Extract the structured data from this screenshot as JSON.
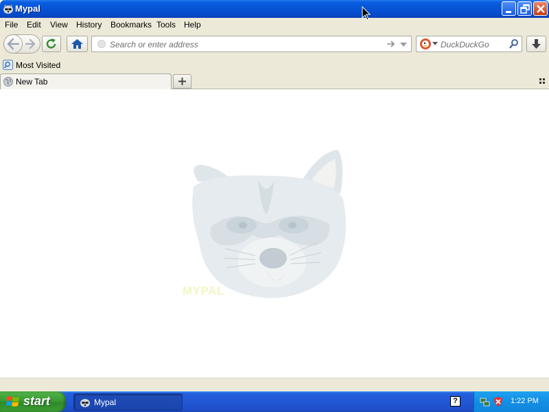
{
  "window": {
    "title": "Mypal",
    "controls": {
      "minimize": "minimize-icon",
      "restore": "restore-icon",
      "close": "close-icon"
    }
  },
  "menu": {
    "items": [
      {
        "label": "File",
        "x_hint": "file"
      },
      {
        "label": "Edit",
        "x_hint": "edit"
      },
      {
        "label": "View",
        "x_hint": "view"
      },
      {
        "label": "History",
        "x_hint": "history"
      },
      {
        "label": "Bookmarks",
        "x_hint": "bookmarks"
      },
      {
        "label": "Tools",
        "x_hint": "tools"
      },
      {
        "label": "Help",
        "x_hint": "help"
      }
    ]
  },
  "navbar": {
    "url_placeholder": "Search or enter address",
    "search_placeholder": "DuckDuckGo",
    "icons": [
      "back-arrow-icon",
      "forward-arrow-icon",
      "reload-icon",
      "home-icon",
      "go-arrow-icon",
      "dropmarker-icon",
      "duckduckgo-icon",
      "magnifier-icon",
      "download-icon"
    ]
  },
  "bookmarks": {
    "items": [
      {
        "label": "Most Visited",
        "icon": "bookmark-folder-icon"
      }
    ]
  },
  "tabs": {
    "items": [
      {
        "label": "New Tab",
        "icon": "globe-icon",
        "active": true
      }
    ],
    "new_tab_symbol": "+"
  },
  "content": {
    "image": "raccoon-mascot",
    "watermark": "MYPAL"
  },
  "taskbar": {
    "start_label": "start",
    "tasks": [
      {
        "label": "Mypal",
        "icon": "raccoon-icon"
      }
    ],
    "help_symbol": "?",
    "clock": "1:22 PM"
  },
  "colors": {
    "titlebar": "#0753d6",
    "chrome": "#ece9d8",
    "taskbar": "#245edb",
    "start": "#3c9a35",
    "tray": "#138ee4"
  }
}
